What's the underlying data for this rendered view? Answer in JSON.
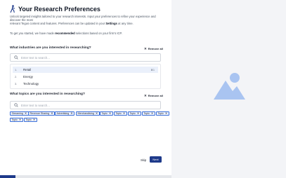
{
  "header": {
    "title": "Your Research Preferences",
    "intro_line1": "Unlock targeted insights tailored to your research interests. Input your preferences to refine your experience and discover the most",
    "intro_line2a": "relevant Tegus content and features. Preferences can be updated in your ",
    "intro_settings": "Settings",
    "intro_line2b": " at any time.",
    "started_a": "To get you started, we have made ",
    "started_bold": "recommended",
    "started_b": " selections based on your firm's ICP."
  },
  "industries": {
    "question": "What industries are you interested in researching?",
    "remove_all": "Remove all",
    "placeholder": "Enter text to search...",
    "options": [
      {
        "num": "1.",
        "label": "Retail",
        "hint": "⌘1"
      },
      {
        "num": "2.",
        "label": "Energy"
      },
      {
        "num": "3.",
        "label": "Technology"
      }
    ]
  },
  "topics": {
    "question": "What topics are you interested in researching?",
    "remove_all": "Remove all",
    "placeholder": "Enter text to search...",
    "tags": [
      "Streaming",
      "Revenue Sharing",
      "Advertising",
      "Merchandising",
      "Topic",
      "Topic",
      "Topic",
      "Topic",
      "Topic",
      "Topic",
      "Topic"
    ]
  },
  "footer": {
    "skip_label": "Skip",
    "next_label": "Next",
    "progress_fraction": 0.09
  },
  "colors": {
    "accent": "#1e3a8a",
    "tag_border": "#3b6fd8",
    "illustration": "#a9c4f1"
  }
}
